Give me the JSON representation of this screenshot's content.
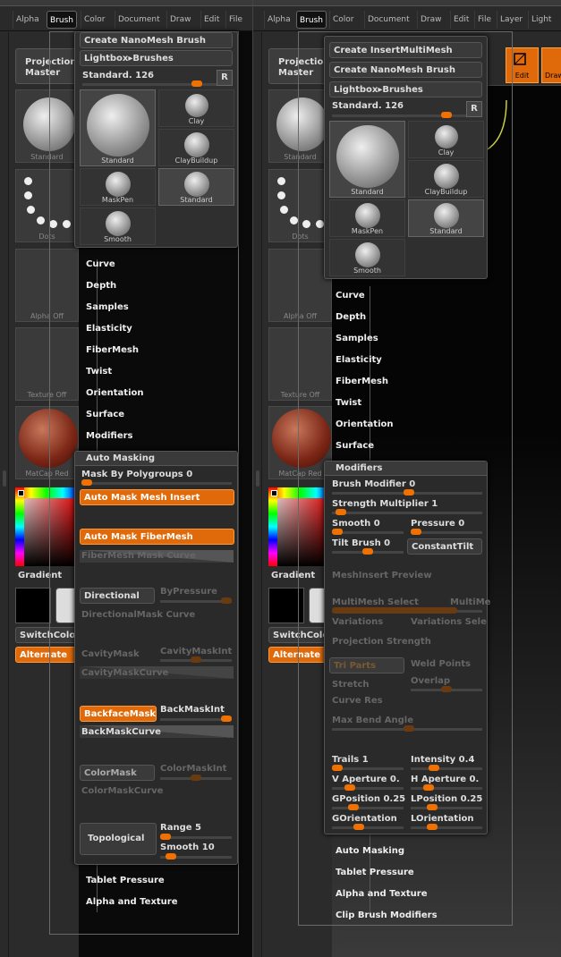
{
  "menu_left": [
    "Alpha",
    "Brush",
    "Color",
    "Document",
    "Draw",
    "Edit",
    "File"
  ],
  "menu_right": [
    "Alpha",
    "Brush",
    "Color",
    "Document",
    "Draw",
    "Edit",
    "File",
    "Layer",
    "Light"
  ],
  "active_menu": "Brush",
  "left_shelf": {
    "projection_master": "Projection Master",
    "thumb_labels": [
      "Standard",
      "Dots",
      "Alpha  Off",
      "Texture  Off",
      "MatCap  Red"
    ],
    "gradient_label": "Gradient",
    "switch_color": "SwitchColor",
    "alternate": "Alternate"
  },
  "right_toolbar": {
    "edit": "Edit",
    "draw": "Draw"
  },
  "brush_popup_left": {
    "create_nanomesh": "Create NanoMesh Brush",
    "lightbox": "Lightbox▸Brushes",
    "current": "Standard. 126",
    "r_button": "R",
    "brushes": [
      "Standard",
      "Clay",
      "ClayBuildup",
      "MaskPen",
      "Standard",
      "Smooth"
    ]
  },
  "brush_popup_right": {
    "create_insertmulti": "Create InsertMultiMesh",
    "create_nanomesh": "Create NanoMesh Brush",
    "lightbox": "Lightbox▸Brushes",
    "current": "Standard. 126",
    "r_button": "R",
    "brushes": [
      "Standard",
      "Clay",
      "ClayBuildup",
      "MaskPen",
      "Standard",
      "Smooth"
    ]
  },
  "sections_left": [
    "Curve",
    "Depth",
    "Samples",
    "Elasticity",
    "FiberMesh",
    "Twist",
    "Orientation",
    "Surface",
    "Modifiers"
  ],
  "sections_left_bottom": [
    "Tablet Pressure",
    "Alpha and Texture"
  ],
  "sections_right": [
    "Curve",
    "Depth",
    "Samples",
    "Elasticity",
    "FiberMesh",
    "Twist",
    "Orientation",
    "Surface"
  ],
  "sections_right_bottom": [
    "Auto Masking",
    "Tablet Pressure",
    "Alpha and Texture",
    "Clip Brush Modifiers"
  ],
  "auto_masking": {
    "title": "Auto Masking",
    "mask_by_polygroups": "Mask By Polygroups 0",
    "mesh_insert": "Auto Mask Mesh Insert",
    "fibermesh": "Auto Mask FiberMesh",
    "fibermesh_curve": "FiberMesh Mask Curve",
    "directional": "Directional",
    "by_pressure": "ByPressure",
    "directional_curve": "DirectionalMask Curve",
    "cavity": "CavityMask",
    "cavity_int": "CavityMaskInt",
    "cavity_curve": "CavityMaskCurve",
    "backface": "BackfaceMask",
    "backmask_int": "BackMaskInt",
    "backmask_curve": "BackMaskCurve",
    "colormask": "ColorMask",
    "colormask_int": "ColorMaskInt",
    "colormask_curve": "ColorMaskCurve",
    "topological": "Topological",
    "range": "Range 5",
    "smooth": "Smooth 10"
  },
  "modifiers": {
    "title": "Modifiers",
    "brush_modifier": "Brush Modifier 0",
    "strength_multiplier": "Strength Multiplier 1",
    "smooth": "Smooth 0",
    "pressure": "Pressure 0",
    "tilt_brush": "Tilt Brush 0",
    "constant_tilt": "ConstantTilt",
    "meshinsert_preview": "MeshInsert Preview",
    "multimesh_select": "MultiMesh Select",
    "multime": "MultiMe",
    "variations": "Variations",
    "variations_sel": "Variations Sele",
    "projection_strength": "Projection Strength",
    "tri_parts": "Tri Parts",
    "weld_points": "Weld Points",
    "stretch": "Stretch",
    "overlap": "Overlap",
    "curve_res": "Curve Res",
    "max_bend": "Max Bend Angle",
    "trails": "Trails 1",
    "intensity": "Intensity 0.4",
    "v_aperture": "V Aperture 0.",
    "h_aperture": "H Aperture 0.",
    "gposition": "GPosition 0.25",
    "lposition": "LPosition 0.25",
    "gorientation": "GOrientation",
    "lorientation": "LOrientation"
  },
  "colors": {
    "accent": "#e06a0a"
  }
}
